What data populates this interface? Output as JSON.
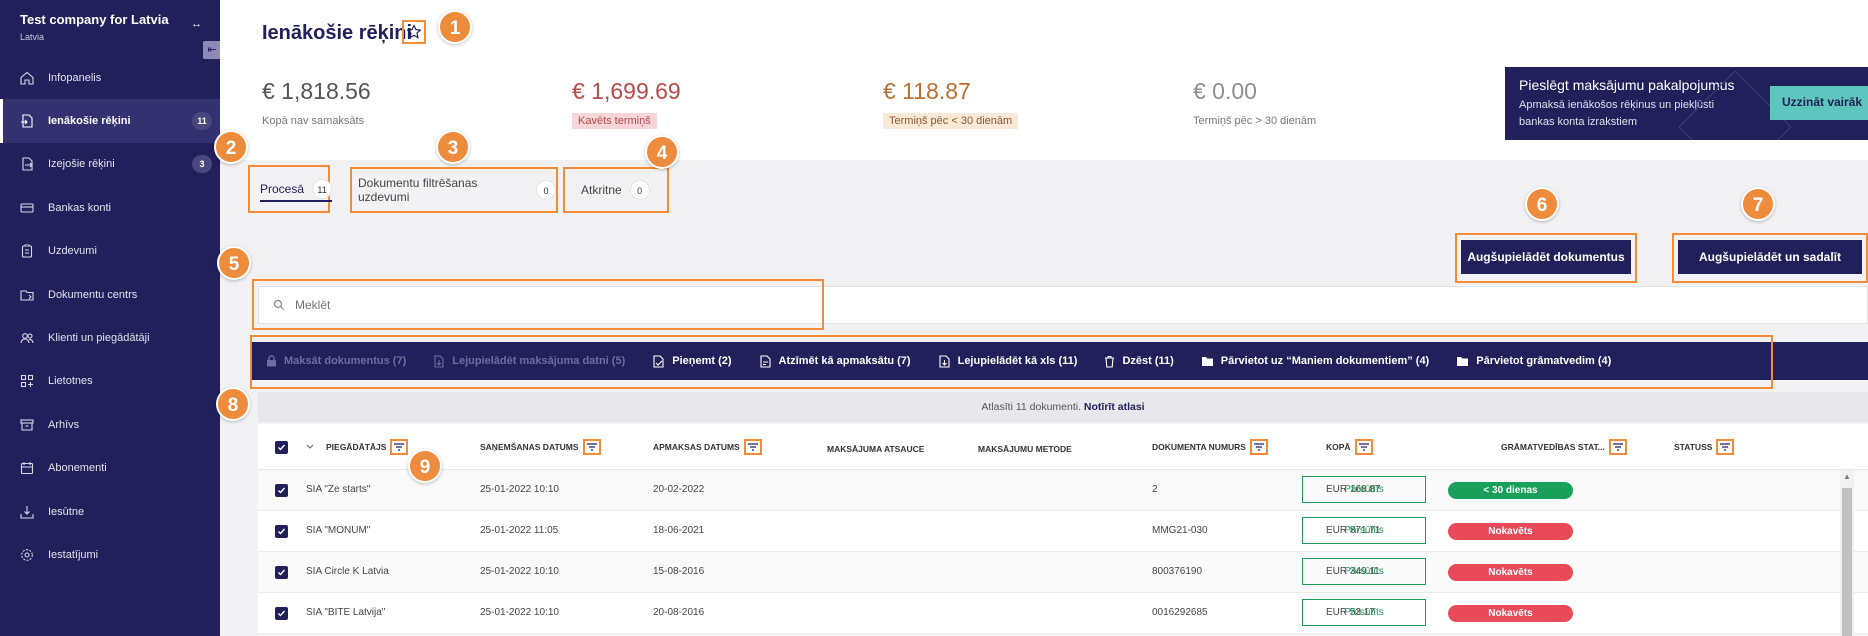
{
  "company": {
    "name": "Test company for Latvia",
    "country": "Latvia"
  },
  "sidebar": {
    "items": [
      {
        "label": "Infopanelis",
        "icon": "home-icon",
        "badge": ""
      },
      {
        "label": "Ienākošie rēķini",
        "icon": "incoming-invoice-icon",
        "badge": "11",
        "active": true
      },
      {
        "label": "Izejošie rēķini",
        "icon": "outgoing-invoice-icon",
        "badge": "3"
      },
      {
        "label": "Bankas konti",
        "icon": "bank-icon",
        "badge": ""
      },
      {
        "label": "Uzdevumi",
        "icon": "clipboard-icon",
        "badge": ""
      },
      {
        "label": "Dokumentu centrs",
        "icon": "documents-icon",
        "badge": ""
      },
      {
        "label": "Klienti un piegādātāji",
        "icon": "people-icon",
        "badge": ""
      },
      {
        "label": "Lietotnes",
        "icon": "apps-icon",
        "badge": ""
      },
      {
        "label": "Arhīvs",
        "icon": "archive-icon",
        "badge": ""
      },
      {
        "label": "Abonementi",
        "icon": "subscription-icon",
        "badge": ""
      },
      {
        "label": "Iesūtne",
        "icon": "inbox-icon",
        "badge": ""
      },
      {
        "label": "Iestatījumi",
        "icon": "settings-icon",
        "badge": ""
      }
    ]
  },
  "page": {
    "title": "Ienākošie rēķini"
  },
  "kpis": [
    {
      "value": "€ 1,818.56",
      "label": "Kopā nav samaksāts"
    },
    {
      "value": "€ 1,699.69",
      "label": "Kavēts termiņš"
    },
    {
      "value": "€ 118.87",
      "label": "Termiņš pēc < 30 dienām"
    },
    {
      "value": "€ 0.00",
      "label": "Termiņš pēc > 30 dienām"
    }
  ],
  "promo": {
    "title": "Pieslēgt maksājumu pakalpojumus",
    "text": "Apmaksā ienākošos rēķinus un piekļūsti bankas konta izrakstiem",
    "button": "Uzzināt vairāk"
  },
  "tabs": [
    {
      "label": "Procesā",
      "count": "11"
    },
    {
      "label": "Dokumentu filtrēšanas uzdevumi",
      "count": "0"
    },
    {
      "label": "Atkritne",
      "count": "0"
    }
  ],
  "buttons": {
    "upload": "Augšupielādēt dokumentus",
    "upload_split": "Augšupielādēt un sadalīt"
  },
  "search": {
    "placeholder": "Meklēt"
  },
  "actions": [
    {
      "label": "Maksāt dokumentus (7)",
      "icon": "lock-icon",
      "disabled": true
    },
    {
      "label": "Lejupielādēt maksājuma datni (5)",
      "icon": "file-download-icon",
      "disabled": true
    },
    {
      "label": "Pieņemt (2)",
      "icon": "accept-icon",
      "disabled": false
    },
    {
      "label": "Atzīmēt kā apmaksātu (7)",
      "icon": "mark-paid-icon",
      "disabled": false
    },
    {
      "label": "Lejupielādēt kā xls (11)",
      "icon": "xls-download-icon",
      "disabled": false
    },
    {
      "label": "Dzēst (11)",
      "icon": "trash-icon",
      "disabled": false
    },
    {
      "label": "Pārvietot uz “Maniem dokumentiem” (4)",
      "icon": "folder-icon",
      "disabled": false
    },
    {
      "label": "Pārvietot grāmatvedim (4)",
      "icon": "folder-icon",
      "disabled": false
    }
  ],
  "selection": {
    "text": "Atlasīti 11 dokumenti.",
    "clear": "Notīrīt atlasi"
  },
  "table": {
    "headers": {
      "supplier": "PIEGĀDĀTĀJS",
      "received": "SAŅEMŠANAS DATUMS",
      "due": "APMAKSAS DATUMS",
      "reference": "MAKSĀJUMA ATSAUCE",
      "method": "MAKSĀJUMU METODE",
      "docnum": "DOKUMENTA NUMURS",
      "total": "KOPĀ",
      "acc_status": "GRĀMATVEDĪBAS STAT...",
      "status": "STATUSS"
    },
    "rows": [
      {
        "supplier": "SIA \"Ze starts\"",
        "received": "25-01-2022 10:10",
        "due": "20-02-2022",
        "docnum": "2",
        "total": "EUR 168.87",
        "acc_status": "Pārsūtīts",
        "status": "< 30 dienas",
        "status_color": "#1aa05a"
      },
      {
        "supplier": "SIA \"MONUM\"",
        "received": "25-01-2022 11:05",
        "due": "18-06-2021",
        "docnum": "MMG21-030",
        "total": "EUR 871.71",
        "acc_status": "Pārsūtīts",
        "status": "Nokavēts",
        "status_color": "#e84a5a"
      },
      {
        "supplier": "SIA Circle K Latvia",
        "received": "25-01-2022 10:10",
        "due": "15-08-2016",
        "docnum": "800376190",
        "total": "EUR 349.11",
        "acc_status": "Pārsūtīts",
        "status": "Nokavēts",
        "status_color": "#e84a5a"
      },
      {
        "supplier": "SIA \"BITE Latvija\"",
        "received": "25-01-2022 10:10",
        "due": "20-08-2016",
        "docnum": "0016292685",
        "total": "EUR 53.17",
        "acc_status": "Pārsūtīts",
        "status": "Nokavēts",
        "status_color": "#e84a5a"
      }
    ]
  },
  "annotations": [
    "1",
    "2",
    "3",
    "4",
    "5",
    "6",
    "7",
    "8",
    "9"
  ],
  "colors": {
    "sidebar": "#22205a",
    "accent_orange": "#f28c38",
    "success": "#1aa05a",
    "danger": "#e84a5a",
    "promo_button": "#5ec6bd"
  }
}
